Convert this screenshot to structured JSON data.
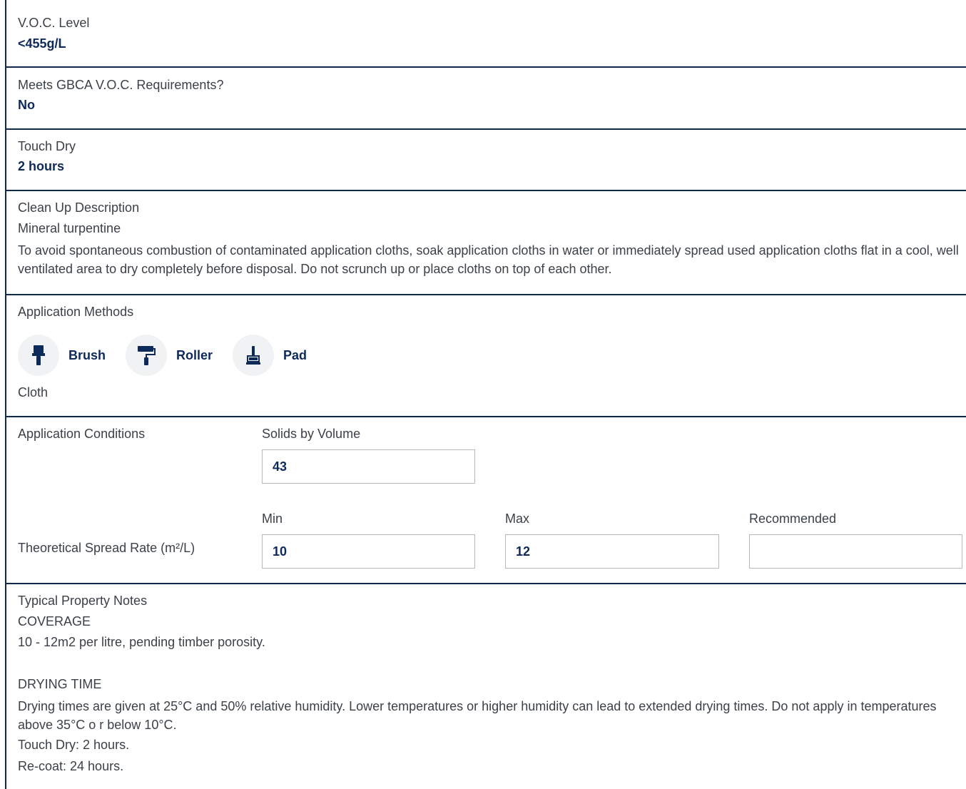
{
  "voc": {
    "label": "V.O.C. Level",
    "value": "<455g/L"
  },
  "gbca": {
    "label": "Meets GBCA V.O.C. Requirements?",
    "value": "No"
  },
  "touch_dry": {
    "label": "Touch Dry",
    "value": "2 hours"
  },
  "clean_up": {
    "label": "Clean Up Description",
    "solvent": "Mineral turpentine",
    "description": "To avoid spontaneous combustion of contaminated application cloths, soak application cloths in water or immediately spread used application cloths flat in a cool, well ventilated area to dry completely before disposal. Do not scrunch up or place cloths on top of each other."
  },
  "application_methods": {
    "label": "Application Methods",
    "methods": [
      {
        "label": "Brush",
        "icon": "brush-icon"
      },
      {
        "label": "Roller",
        "icon": "roller-icon"
      },
      {
        "label": "Pad",
        "icon": "pad-icon"
      }
    ],
    "other": "Cloth"
  },
  "application_conditions": {
    "label": "Application Conditions",
    "solids_label": "Solids by Volume",
    "solids_value": "43",
    "spread_label": "Theoretical Spread Rate (m²/L)",
    "min_label": "Min",
    "min_value": "10",
    "max_label": "Max",
    "max_value": "12",
    "recommended_label": "Recommended",
    "recommended_value": ""
  },
  "property_notes": {
    "label": "Typical Property Notes",
    "coverage_heading": "COVERAGE",
    "coverage_text": "10 - 12m2 per litre, pending timber porosity.",
    "drying_heading": "DRYING TIME",
    "drying_text": "Drying times are given at 25°C and 50% relative humidity. Lower temperatures or higher humidity can lead to extended drying times. Do not apply in temperatures above 35°C o r below 10°C.",
    "touch_dry_text": "Touch Dry: 2 hours.",
    "recoat_text": "Re-coat: 24 hours."
  },
  "colors": {
    "accent": "#0e2a5a",
    "border": "#0e2a47",
    "icon_bg": "#f1f2f3"
  }
}
